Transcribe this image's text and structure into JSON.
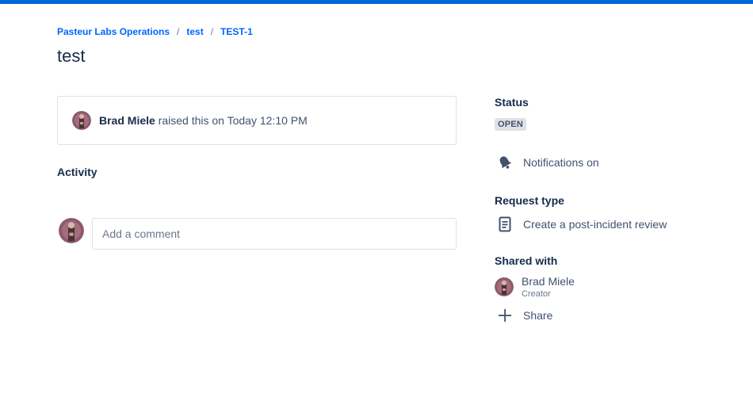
{
  "breadcrumb": {
    "items": [
      "Pasteur Labs Operations",
      "test",
      "TEST-1"
    ],
    "separator": "/"
  },
  "page": {
    "title": "test"
  },
  "raised": {
    "user": "Brad Miele",
    "text": "raised this on Today 12:10 PM"
  },
  "activity": {
    "heading": "Activity",
    "comment_placeholder": "Add a comment"
  },
  "sidebar": {
    "status_heading": "Status",
    "status_value": "OPEN",
    "notifications_label": "Notifications on",
    "request_type_heading": "Request type",
    "request_type_value": "Create a post-incident review",
    "shared_with_heading": "Shared with",
    "shared_user_name": "Brad Miele",
    "shared_user_role": "Creator",
    "share_label": "Share"
  },
  "colors": {
    "top_bar": "#0069d9",
    "link": "#0065ff",
    "text_primary": "#172b4d",
    "text_secondary": "#42526e"
  },
  "icons": {
    "notifications": "bell-icon",
    "request_type": "document-icon",
    "share": "plus-icon"
  }
}
